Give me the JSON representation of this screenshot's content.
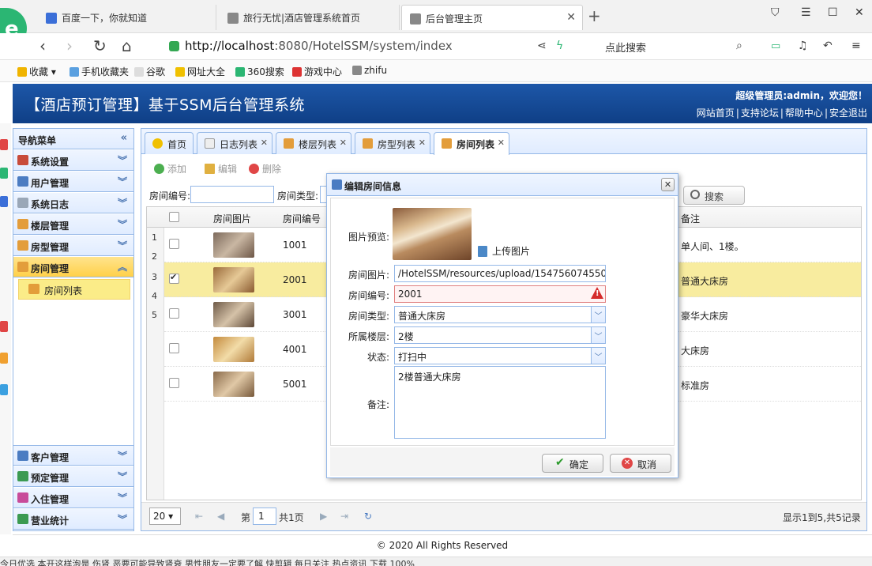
{
  "browser": {
    "tabs": [
      {
        "label": "百度一下，你就知道",
        "icon": "paw-icon"
      },
      {
        "label": "旅行无忧|酒店管理系统首页",
        "icon": "page-icon"
      },
      {
        "label": "后台管理主页",
        "icon": "page-icon"
      }
    ],
    "url_host": "http://localhost",
    "url_path": ":8080/HotelSSM/system/index",
    "search_placeholder": "点此搜索",
    "bookmarks": [
      "收藏",
      "手机收藏夹",
      "谷歌",
      "网址大全",
      "360搜索",
      "游戏中心",
      "zhifu"
    ]
  },
  "app": {
    "title": "【酒店预订管理】基于SSM后台管理系统",
    "welcome": "超级管理员:admin，欢迎您！",
    "links": [
      "网站首页",
      "支持论坛",
      "帮助中心",
      "安全退出"
    ],
    "footer": "© 2020 All Rights Reserved"
  },
  "sidebar": {
    "header": "导航菜单",
    "top_items": [
      "系统设置",
      "用户管理",
      "系统日志",
      "楼层管理",
      "房型管理",
      "房间管理"
    ],
    "sub_item": "房间列表",
    "bottom_items": [
      "客户管理",
      "预定管理",
      "入住管理",
      "营业统计"
    ]
  },
  "tabs": [
    "首页",
    "日志列表",
    "楼层列表",
    "房型列表",
    "房间列表"
  ],
  "toolbar": {
    "add": "添加",
    "edit": "编辑",
    "delete": "删除"
  },
  "filter": {
    "room_no_label": "房间编号:",
    "room_type_label": "房间类型:",
    "search": "搜索"
  },
  "grid": {
    "headers": {
      "photo": "房间图片",
      "number": "房间编号",
      "note": "备注"
    },
    "rows": [
      {
        "number": "1001",
        "note": "单人间、1楼。",
        "checked": false
      },
      {
        "number": "2001",
        "note": "普通大床房",
        "checked": true
      },
      {
        "number": "3001",
        "note": "豪华大床房",
        "checked": false
      },
      {
        "number": "4001",
        "note": "大床房",
        "checked": false
      },
      {
        "number": "5001",
        "note": "标准房",
        "checked": false
      }
    ],
    "row_numbers": [
      "1",
      "2",
      "3",
      "4",
      "5"
    ]
  },
  "pager": {
    "page_size": "20",
    "page_prefix": "第",
    "page_value": "1",
    "page_suffix": "共1页",
    "summary": "显示1到5,共5记录"
  },
  "dialog": {
    "title": "编辑房间信息",
    "preview_label": "图片预览:",
    "upload_label": "上传图片",
    "photo_label": "房间图片:",
    "photo_value": "/HotelSSM/resources/upload/154756074550",
    "number_label": "房间编号:",
    "number_value": "2001",
    "type_label": "房间类型:",
    "type_value": "普通大床房",
    "floor_label": "所属楼层:",
    "floor_value": "2楼",
    "status_label": "状态:",
    "status_value": "打扫中",
    "note_label": "备注:",
    "note_value": "2楼普通大床房",
    "ok": "确定",
    "cancel": "取消"
  },
  "status_bar": "今日优选   本开这样泡是 伤肾   恶要可能导致肾衰   男性朋友一定要了解   快剪辑   每日关注   热点资讯   下载   100%",
  "colors": {
    "header_blue": "#1d57a8",
    "panel_border": "#95b8e7",
    "selected_row": "#f8ec9f",
    "selected_nav": "#ffd049"
  }
}
